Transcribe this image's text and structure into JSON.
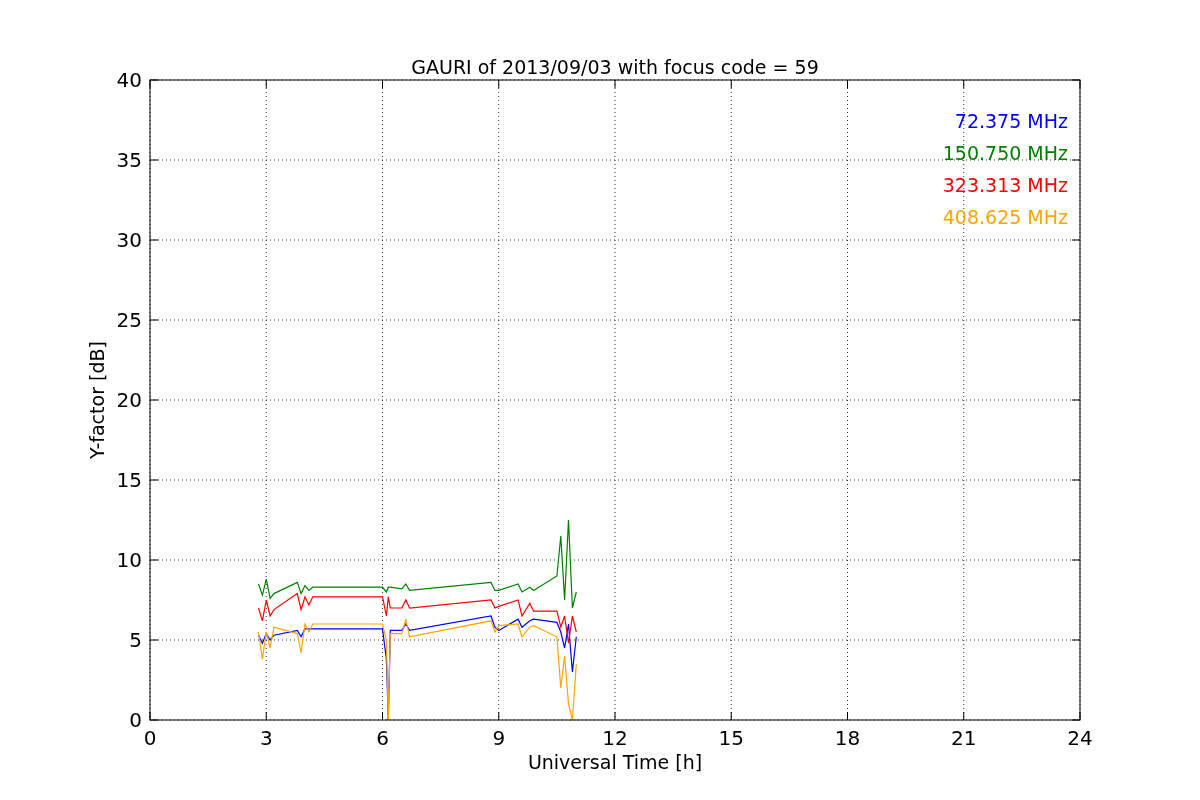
{
  "chart_data": {
    "type": "line",
    "title": "GAURI of 2013/09/03 with focus code = 59",
    "xlabel": "Universal Time [h]",
    "ylabel": "Y-factor [dB]",
    "x": [
      2.8,
      2.9,
      3.0,
      3.1,
      3.2,
      3.8,
      3.9,
      4.0,
      4.1,
      4.2,
      6.0,
      6.1,
      6.15,
      6.2,
      6.5,
      6.6,
      6.7,
      8.8,
      8.9,
      9.0,
      9.5,
      9.6,
      9.8,
      9.9,
      10.5,
      10.6,
      10.7,
      10.8,
      10.9,
      11.0
    ],
    "series": [
      {
        "name": "72.375 MHz",
        "color": "#0000ff",
        "values": [
          5.3,
          4.8,
          5.4,
          5.0,
          5.3,
          5.6,
          5.2,
          5.7,
          5.7,
          5.7,
          5.7,
          3.8,
          0,
          5.6,
          5.6,
          6.0,
          5.6,
          6.5,
          5.8,
          5.6,
          6.3,
          5.8,
          6.2,
          6.3,
          6.1,
          5.5,
          4.5,
          6.0,
          3.0,
          5.2
        ]
      },
      {
        "name": "150.750 MHz",
        "color": "#008000",
        "values": [
          8.5,
          7.8,
          8.8,
          7.6,
          7.9,
          8.6,
          7.9,
          8.4,
          8.1,
          8.3,
          8.3,
          8.0,
          8.3,
          8.3,
          8.2,
          8.5,
          8.1,
          8.6,
          8.1,
          8.1,
          8.5,
          8.0,
          8.3,
          8.1,
          9.0,
          11.5,
          7.5,
          12.5,
          7.0,
          8.0
        ]
      },
      {
        "name": "323.313 MHz",
        "color": "#ff0000",
        "values": [
          7.0,
          6.2,
          7.5,
          6.5,
          6.9,
          7.9,
          6.9,
          7.7,
          7.2,
          7.7,
          7.7,
          6.5,
          7.7,
          7.0,
          7.0,
          7.5,
          7.0,
          7.5,
          7.0,
          7.1,
          7.5,
          6.5,
          7.3,
          6.8,
          6.8,
          5.8,
          6.5,
          4.8,
          6.5,
          5.5
        ]
      },
      {
        "name": "408.625 MHz",
        "color": "#ffa500",
        "values": [
          5.5,
          3.8,
          5.5,
          4.5,
          5.8,
          5.4,
          4.2,
          6.0,
          5.5,
          6.0,
          6.0,
          5.0,
          0,
          5.4,
          5.4,
          6.3,
          5.2,
          6.2,
          5.5,
          5.9,
          6.0,
          5.2,
          5.8,
          5.9,
          5.2,
          2.0,
          4.0,
          1.0,
          0,
          3.5
        ]
      }
    ],
    "grid": true,
    "xlim": [
      0,
      24
    ],
    "ylim": [
      0,
      40
    ],
    "xticks": [
      0,
      3,
      6,
      9,
      12,
      15,
      18,
      21,
      24
    ],
    "yticks": [
      0,
      5,
      10,
      15,
      20,
      25,
      30,
      35,
      40
    ]
  }
}
